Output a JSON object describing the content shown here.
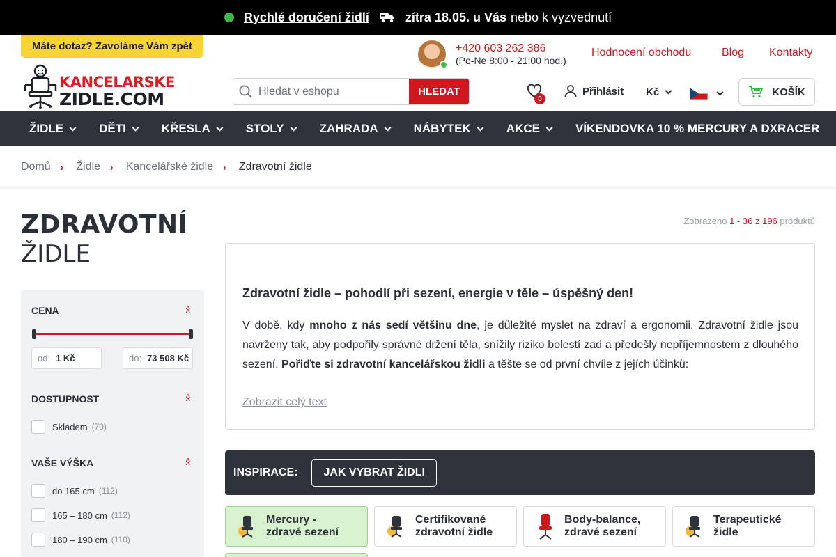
{
  "promo": {
    "fast_delivery": "Rychlé doručení židlí",
    "tomorrow": "zítra 18.05. u Vás",
    "pickup": "nebo k vyzvednutí",
    "dot_color": "#3fb94a"
  },
  "header": {
    "callback": "Máte dotaz? Zavoláme Vám zpět",
    "logo_line1": "KANCELARSKE",
    "logo_line2": "ZIDLE.COM",
    "phone": "+420 603 262 386",
    "hours": "(Po-Ne 8:00 - 21:00 hod.)",
    "links": [
      "Hodnocení obchodu",
      "Blog",
      "Kontakty"
    ],
    "search_placeholder": "Hledat v eshopu",
    "search_button": "HLEDAT",
    "wishlist_count": "0",
    "login": "Přihlásit",
    "currency": "Kč",
    "cart": "KOŠÍK",
    "accent": "#d2161d"
  },
  "nav": {
    "items": [
      "ŽIDLE",
      "DĚTI",
      "KŘESLA",
      "STOLY",
      "ZAHRADA",
      "NÁBYTEK",
      "AKCE"
    ],
    "promo_item": "VÍKENDOVKA 10 % MERCURY A DXRACER"
  },
  "breadcrumb": [
    "Domů",
    "Židle",
    "Kancelářské židle",
    "Zdravotní židle"
  ],
  "page": {
    "title_line1": "ZDRAVOTNÍ",
    "title_line2": "ŽIDLE",
    "shown_prefix": "Zobrazeno",
    "shown_range": "1 - 36 z 196",
    "shown_suffix": "produktů"
  },
  "filters": {
    "price": {
      "title": "CENA",
      "from_label": "od:",
      "from_value": "1 Kč",
      "to_label": "do:",
      "to_value": "73 508 Kč"
    },
    "availability": {
      "title": "DOSTUPNOST",
      "options": [
        {
          "label": "Skladem",
          "count": "(70)"
        }
      ]
    },
    "height": {
      "title": "VAŠE VÝŠKA",
      "options": [
        {
          "label": "do 165 cm",
          "count": "(112)"
        },
        {
          "label": "165 – 180 cm",
          "count": "(112)"
        },
        {
          "label": "180 – 190 cm",
          "count": "(110)"
        }
      ]
    }
  },
  "description": {
    "heading": "Zdravotní židle – pohodlí při sezení, energie v těle – úspěšný den!",
    "p_1": "V době, kdy ",
    "p_b1": "mnoho z nás sedí většinu dne",
    "p_2": ", je důležité myslet na zdraví a ergonomii. Zdravotní židle jsou navrženy tak, aby podpořily správné držení těla, snížily riziko bolestí zad a předešly nepříjemnostem z dlouhého sezení. ",
    "p_b2": "Pořiďte si zdravotní kancelářskou židli",
    "p_3": " a těšte se od první chvíle z jejích účinků:",
    "more": "Zobrazit celý text"
  },
  "inspiration": {
    "label": "INSPIRACE:",
    "button": "JAK VYBRAT ŽIDLI"
  },
  "categories": [
    {
      "line1": "Mercury -",
      "line2": "zdravé sezení"
    },
    {
      "line1": "Certifikované",
      "line2": "zdravotní židle"
    },
    {
      "line1": "Body-balance,",
      "line2": "zdravé sezení"
    },
    {
      "line1": "Terapeutické",
      "line2": "židle"
    }
  ]
}
